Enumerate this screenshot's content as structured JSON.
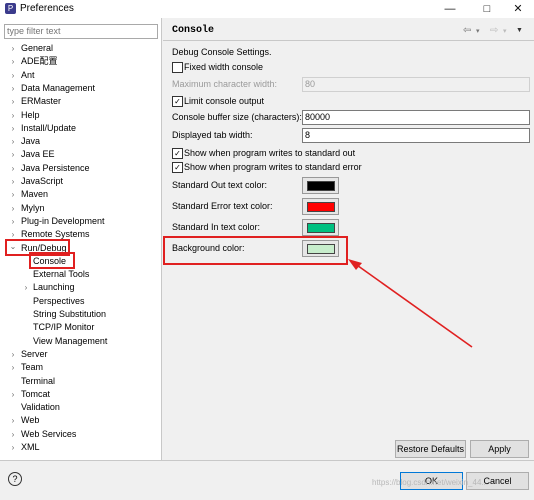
{
  "window": {
    "title": "Preferences",
    "icon": "preferences-icon",
    "minimize": "—",
    "maximize": "□",
    "close": "✕"
  },
  "filter": {
    "placeholder": "type filter text"
  },
  "tree": [
    {
      "label": "General",
      "expanded": false
    },
    {
      "label": "ADE配置",
      "expanded": false
    },
    {
      "label": "Ant",
      "expanded": false
    },
    {
      "label": "Data Management",
      "expanded": false
    },
    {
      "label": "ERMaster",
      "expanded": false
    },
    {
      "label": "Help",
      "expanded": false
    },
    {
      "label": "Install/Update",
      "expanded": false
    },
    {
      "label": "Java",
      "expanded": false
    },
    {
      "label": "Java EE",
      "expanded": false
    },
    {
      "label": "Java Persistence",
      "expanded": false
    },
    {
      "label": "JavaScript",
      "expanded": false
    },
    {
      "label": "Maven",
      "expanded": false
    },
    {
      "label": "Mylyn",
      "expanded": false
    },
    {
      "label": "Plug-in Development",
      "expanded": false
    },
    {
      "label": "Remote Systems",
      "expanded": false
    },
    {
      "label": "Run/Debug",
      "expanded": true
    },
    {
      "label": "Console",
      "child": true,
      "selected": true
    },
    {
      "label": "External Tools",
      "child": true
    },
    {
      "label": "Launching",
      "child": true,
      "expandable": true
    },
    {
      "label": "Perspectives",
      "child": true
    },
    {
      "label": "String Substitution",
      "child": true
    },
    {
      "label": "TCP/IP Monitor",
      "child": true
    },
    {
      "label": "View Management",
      "child": true
    },
    {
      "label": "Server",
      "expanded": false
    },
    {
      "label": "Team",
      "expanded": false
    },
    {
      "label": "Terminal",
      "expanded": false,
      "leaf": true
    },
    {
      "label": "Tomcat",
      "expanded": false
    },
    {
      "label": "Validation",
      "expanded": false,
      "leaf": true
    },
    {
      "label": "Web",
      "expanded": false
    },
    {
      "label": "Web Services",
      "expanded": false
    },
    {
      "label": "XML",
      "expanded": false
    }
  ],
  "page": {
    "title": "Console",
    "description": "Debug Console Settings.",
    "fixed_width_label": "Fixed width console",
    "fixed_width_checked": false,
    "max_char_width_label": "Maximum character width:",
    "max_char_width_value": "80",
    "limit_output_label": "Limit console output",
    "limit_output_checked": true,
    "buffer_size_label": "Console buffer size (characters):",
    "buffer_size_value": "80000",
    "tab_width_label": "Displayed tab width:",
    "tab_width_value": "8",
    "show_stdout_label": "Show when program writes to standard out",
    "show_stdout_checked": true,
    "show_stderr_label": "Show when program writes to standard error",
    "show_stderr_checked": true,
    "stdout_color_label": "Standard Out text color:",
    "stdout_color": "#000000",
    "stderr_color_label": "Standard Error text color:",
    "stderr_color": "#ff0000",
    "stdin_color_label": "Standard In text color:",
    "stdin_color": "#00c080",
    "background_color_label": "Background color:",
    "background_color": "#c7edcc"
  },
  "buttons": {
    "restore_defaults": "Restore Defaults",
    "apply": "Apply",
    "ok": "OK",
    "cancel": "Cancel",
    "help": "?"
  },
  "annotation_color": "#e02020",
  "watermark": "https://blog.csdn.net/weixin_44..."
}
